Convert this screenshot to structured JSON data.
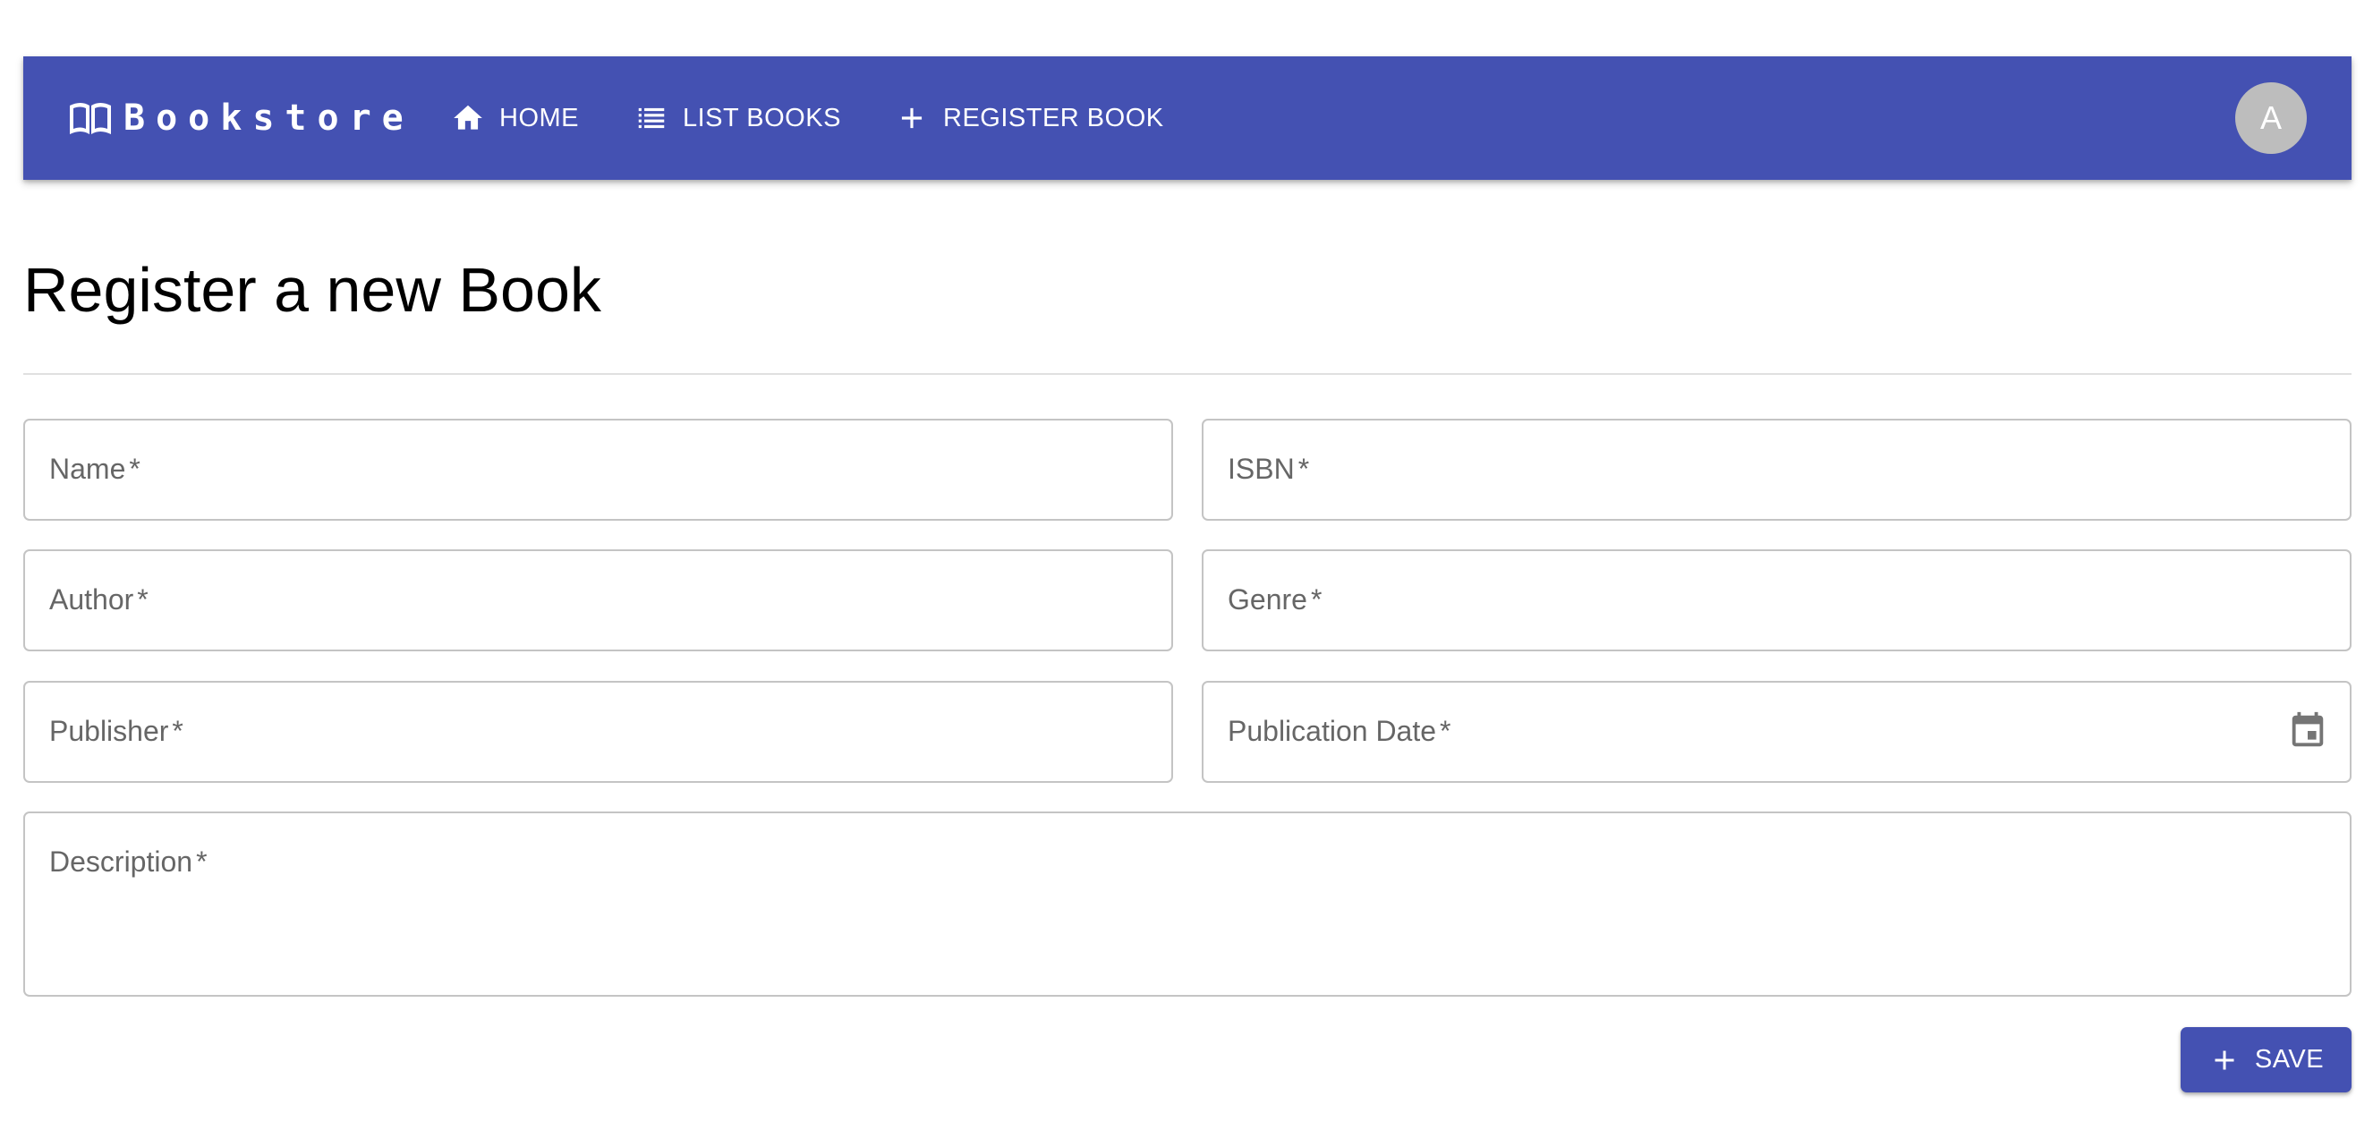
{
  "app": {
    "brand": "Bookstore",
    "brand_icon": "open-book-icon",
    "accent_color": "#4451b2"
  },
  "nav": {
    "items": [
      {
        "label": "HOME",
        "icon": "home-icon"
      },
      {
        "label": "LIST BOOKS",
        "icon": "list-icon"
      },
      {
        "label": "REGISTER BOOK",
        "icon": "plus-icon"
      }
    ]
  },
  "user": {
    "avatar_initial": "A"
  },
  "page": {
    "title": "Register a new Book"
  },
  "form": {
    "required_marker": "*",
    "fields": {
      "name": {
        "label": "Name",
        "value": ""
      },
      "isbn": {
        "label": "ISBN",
        "value": ""
      },
      "author": {
        "label": "Author",
        "value": ""
      },
      "genre": {
        "label": "Genre",
        "value": ""
      },
      "publisher": {
        "label": "Publisher",
        "value": ""
      },
      "publication_date": {
        "label": "Publication Date",
        "value": "",
        "icon": "calendar-icon"
      },
      "description": {
        "label": "Description",
        "value": ""
      }
    },
    "save_button": {
      "label": "SAVE",
      "icon": "plus-icon"
    }
  }
}
